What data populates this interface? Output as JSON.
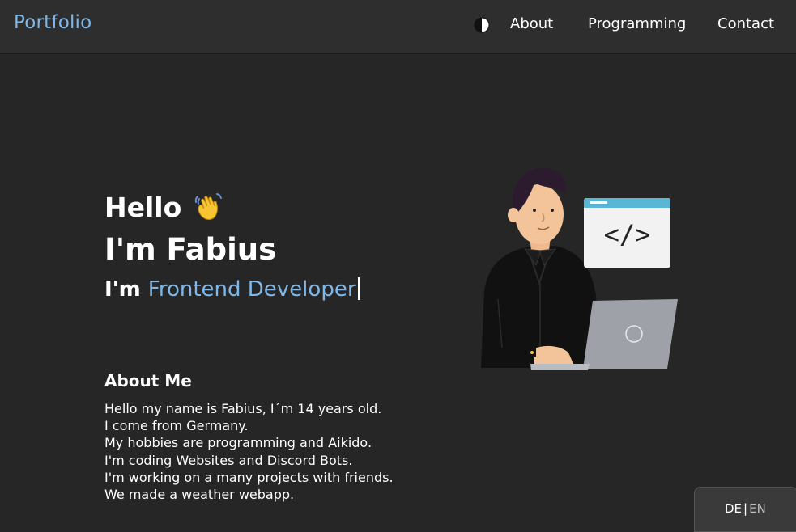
{
  "navbar": {
    "brand": "Portfolio",
    "theme_toggle_icon": "half-circle-contrast-icon",
    "links": [
      {
        "label": "About"
      },
      {
        "label": "Programming"
      },
      {
        "label": "Contact"
      }
    ]
  },
  "hero": {
    "greeting": "Hello",
    "wave_icon": "waving-hand-icon",
    "name_line": "I'm Fabius",
    "role_prefix": "I'm ",
    "role": "Frontend Developer"
  },
  "about": {
    "heading": "About Me",
    "lines": [
      "Hello my name is Fabius, I´m 14 years old.",
      "I come from Germany.",
      "My hobbies are programming and Aikido.",
      "I'm coding Websites and Discord Bots.",
      "I'm working on a many projects with friends.",
      "We made a weather webapp."
    ]
  },
  "illustration": {
    "icon": "developer-with-laptop-illustration",
    "code_window_text": "</>"
  },
  "language_switch": {
    "de": "DE",
    "separator": "|",
    "en": "EN"
  },
  "colors": {
    "background": "#262626",
    "navbar": "#2e2e2e",
    "accent": "#7fb8e8"
  }
}
